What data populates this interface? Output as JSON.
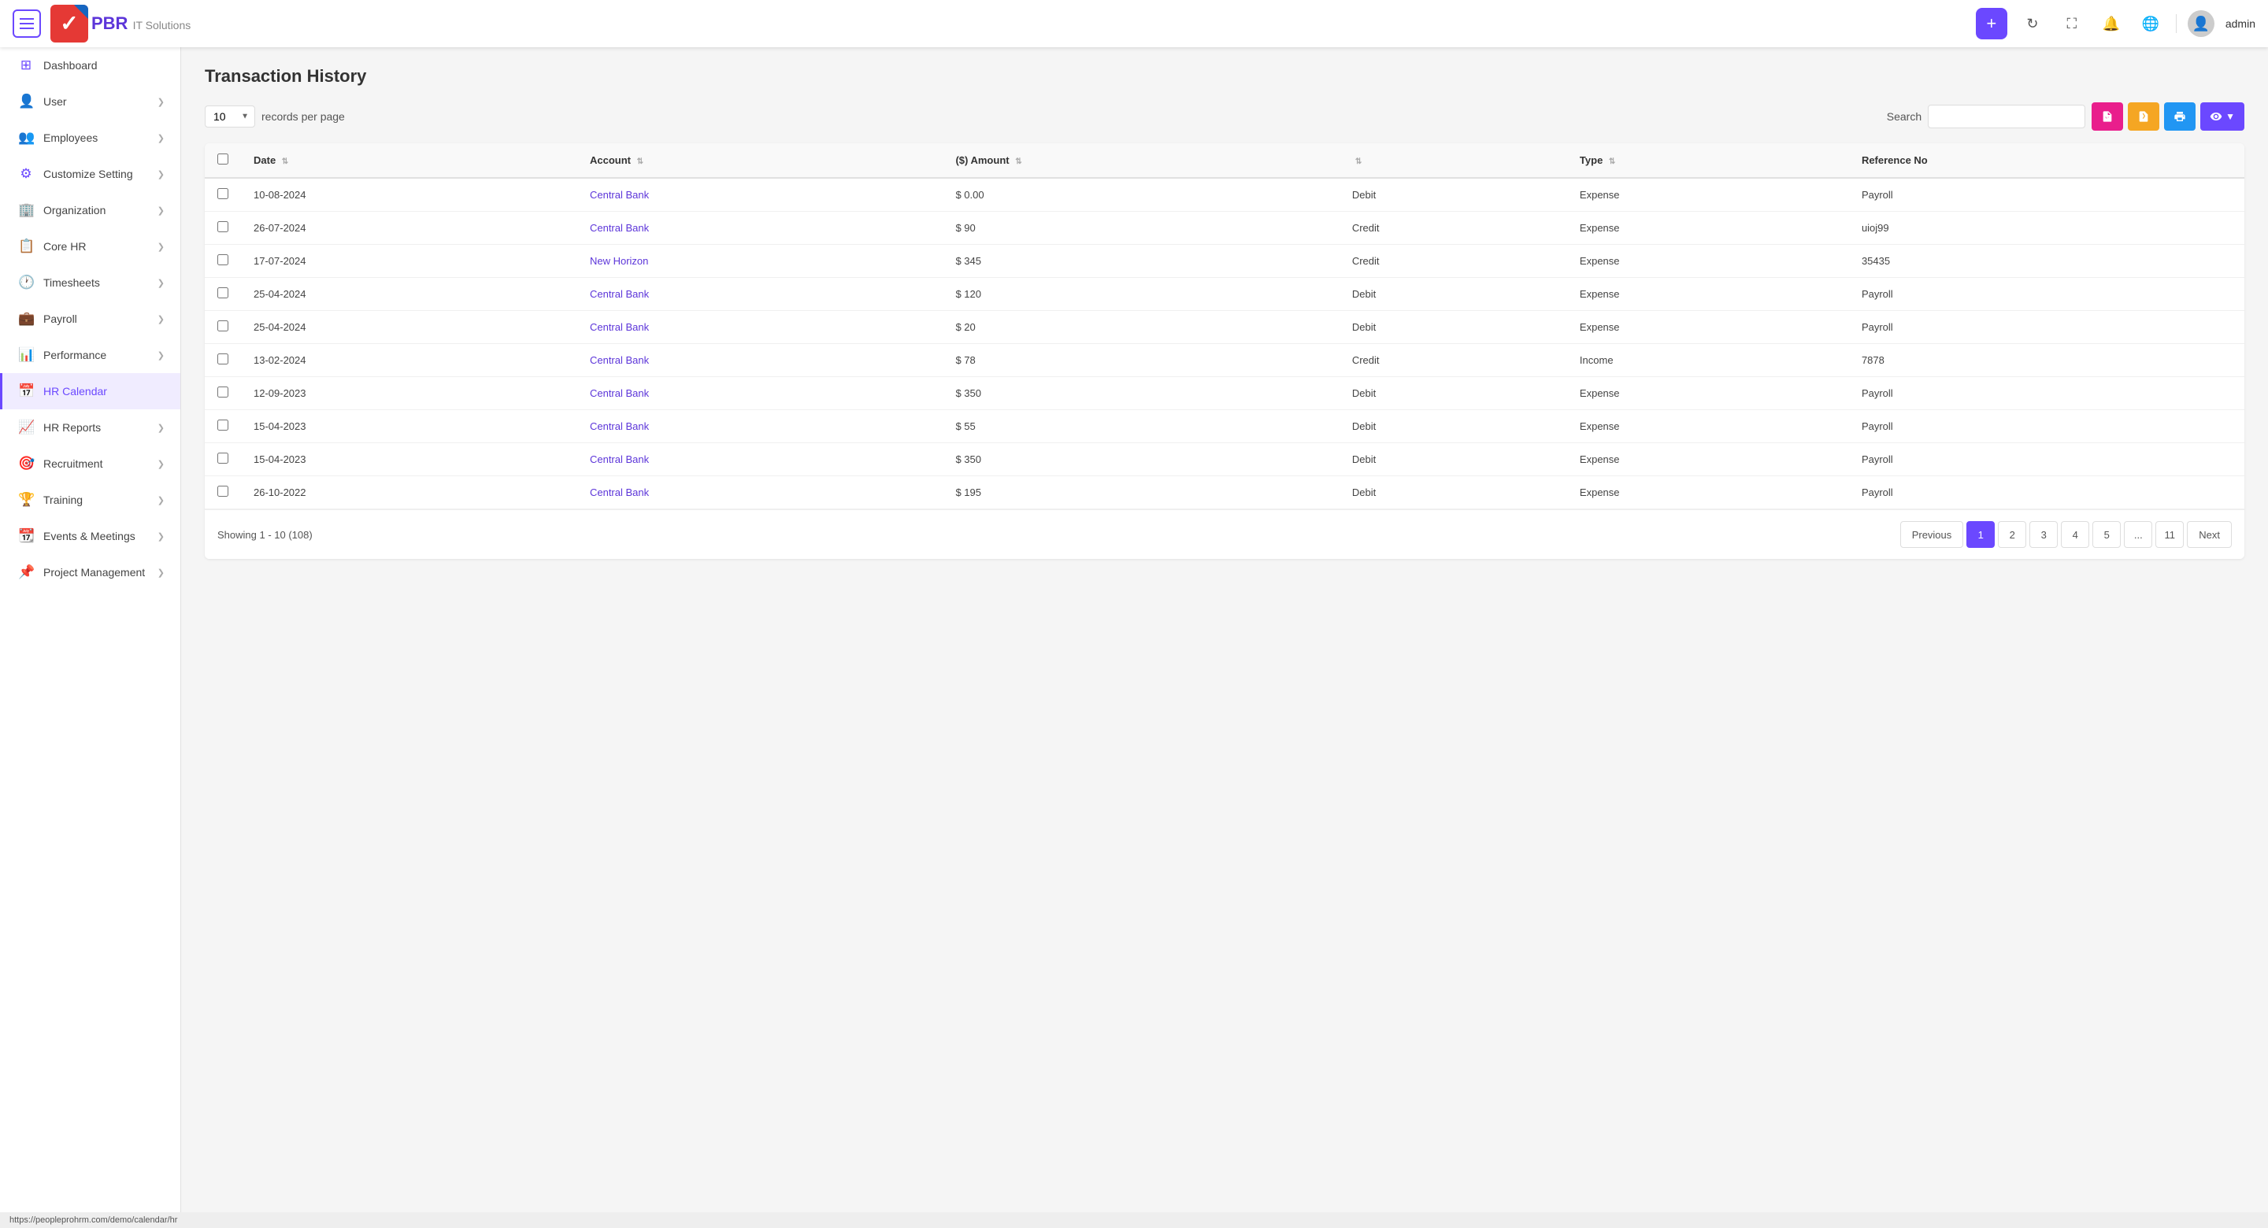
{
  "header": {
    "logo_text": "PBR",
    "logo_sub": "IT Solutions",
    "admin_label": "admin",
    "hamburger_label": "menu"
  },
  "sidebar": {
    "items": [
      {
        "id": "dashboard",
        "label": "Dashboard",
        "icon": "⊞",
        "has_chevron": false
      },
      {
        "id": "user",
        "label": "User",
        "icon": "👤",
        "has_chevron": true
      },
      {
        "id": "employees",
        "label": "Employees",
        "icon": "👥",
        "has_chevron": true
      },
      {
        "id": "customize-setting",
        "label": "Customize Setting",
        "icon": "⚙",
        "has_chevron": true
      },
      {
        "id": "organization",
        "label": "Organization",
        "icon": "🏢",
        "has_chevron": true
      },
      {
        "id": "core-hr",
        "label": "Core HR",
        "icon": "📋",
        "has_chevron": true
      },
      {
        "id": "timesheets",
        "label": "Timesheets",
        "icon": "🕐",
        "has_chevron": true
      },
      {
        "id": "payroll",
        "label": "Payroll",
        "icon": "💼",
        "has_chevron": true
      },
      {
        "id": "performance",
        "label": "Performance",
        "icon": "📊",
        "has_chevron": true
      },
      {
        "id": "hr-calendar",
        "label": "HR Calendar",
        "icon": "📅",
        "has_chevron": false
      },
      {
        "id": "hr-reports",
        "label": "HR Reports",
        "icon": "📈",
        "has_chevron": true
      },
      {
        "id": "recruitment",
        "label": "Recruitment",
        "icon": "🎯",
        "has_chevron": true
      },
      {
        "id": "training",
        "label": "Training",
        "icon": "🏆",
        "has_chevron": true
      },
      {
        "id": "events-meetings",
        "label": "Events & Meetings",
        "icon": "📆",
        "has_chevron": true
      },
      {
        "id": "project-management",
        "label": "Project Management",
        "icon": "📌",
        "has_chevron": true
      }
    ]
  },
  "page": {
    "title": "Transaction History",
    "records_per_page": "10",
    "records_per_page_label": "records per page",
    "search_label": "Search",
    "search_placeholder": ""
  },
  "table": {
    "columns": [
      {
        "id": "date",
        "label": "Date",
        "sortable": true
      },
      {
        "id": "account",
        "label": "Account",
        "sortable": true
      },
      {
        "id": "amount",
        "label": "($) Amount",
        "sortable": true
      },
      {
        "id": "type",
        "label": "Type",
        "sortable": true
      },
      {
        "id": "reference_no",
        "label": "Reference No",
        "sortable": false
      }
    ],
    "rows": [
      {
        "date": "10-08-2024",
        "account": "Central Bank",
        "amount": "$ 0.00",
        "debit_credit": "Debit",
        "type": "Expense",
        "reference_no": "Payroll"
      },
      {
        "date": "26-07-2024",
        "account": "Central Bank",
        "amount": "$ 90",
        "debit_credit": "Credit",
        "type": "Expense",
        "reference_no": "uioj99"
      },
      {
        "date": "17-07-2024",
        "account": "New Horizon",
        "amount": "$ 345",
        "debit_credit": "Credit",
        "type": "Expense",
        "reference_no": "35435"
      },
      {
        "date": "25-04-2024",
        "account": "Central Bank",
        "amount": "$ 120",
        "debit_credit": "Debit",
        "type": "Expense",
        "reference_no": "Payroll"
      },
      {
        "date": "25-04-2024",
        "account": "Central Bank",
        "amount": "$ 20",
        "debit_credit": "Debit",
        "type": "Expense",
        "reference_no": "Payroll"
      },
      {
        "date": "13-02-2024",
        "account": "Central Bank",
        "amount": "$ 78",
        "debit_credit": "Credit",
        "type": "Income",
        "reference_no": "7878"
      },
      {
        "date": "12-09-2023",
        "account": "Central Bank",
        "amount": "$ 350",
        "debit_credit": "Debit",
        "type": "Expense",
        "reference_no": "Payroll"
      },
      {
        "date": "15-04-2023",
        "account": "Central Bank",
        "amount": "$ 55",
        "debit_credit": "Debit",
        "type": "Expense",
        "reference_no": "Payroll"
      },
      {
        "date": "15-04-2023",
        "account": "Central Bank",
        "amount": "$ 350",
        "debit_credit": "Debit",
        "type": "Expense",
        "reference_no": "Payroll"
      },
      {
        "date": "26-10-2022",
        "account": "Central Bank",
        "amount": "$ 195",
        "debit_credit": "Debit",
        "type": "Expense",
        "reference_no": "Payroll"
      }
    ]
  },
  "pagination": {
    "showing_text": "Showing 1 - 10 (108)",
    "prev_label": "Previous",
    "next_label": "Next",
    "pages": [
      "1",
      "2",
      "3",
      "4",
      "5",
      "...",
      "11"
    ],
    "active_page": "1"
  },
  "status_bar": {
    "url": "https://peopleprohrm.com/demo/calendar/hr"
  }
}
